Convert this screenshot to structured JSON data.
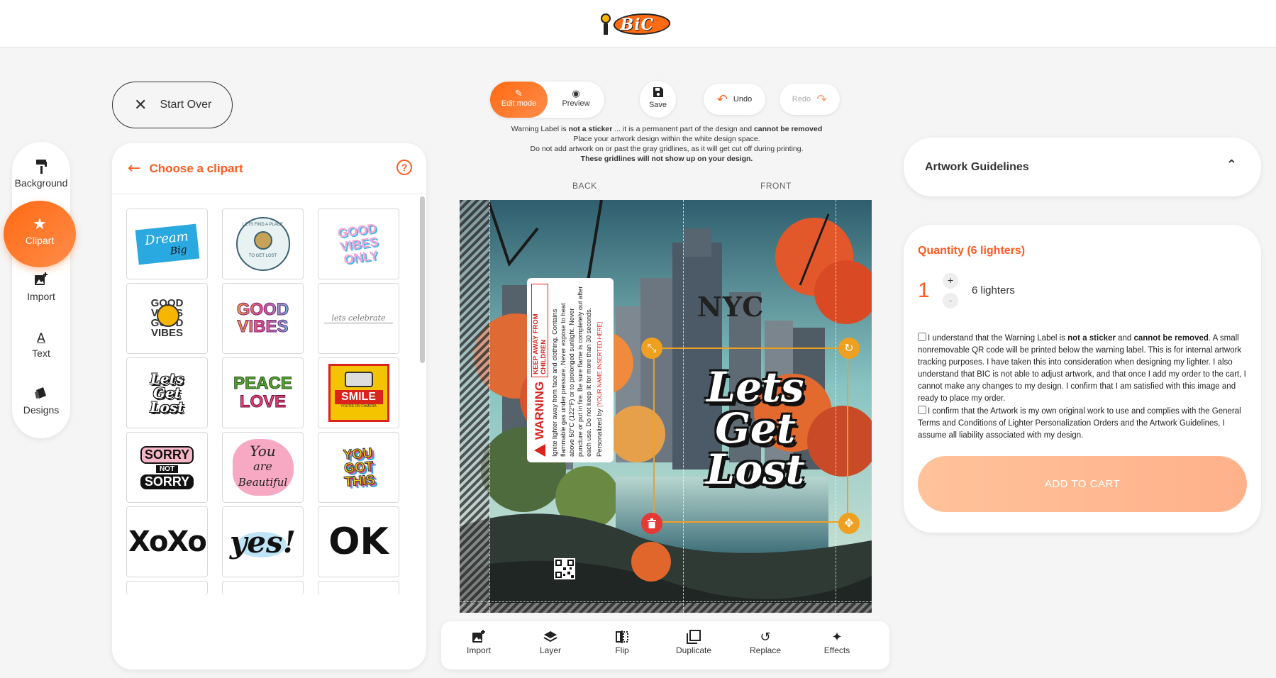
{
  "brand": {
    "logo_text": "BiC"
  },
  "start_over": {
    "label": "Start Over"
  },
  "rail": {
    "items": [
      {
        "label": "Background",
        "icon": "paint-roller-icon"
      },
      {
        "label": "Clipart",
        "icon": "star-icon",
        "active": true
      },
      {
        "label": "Import",
        "icon": "image-add-icon"
      },
      {
        "label": "Text",
        "icon": "text-icon"
      },
      {
        "label": "Designs",
        "icon": "designs-icon"
      }
    ]
  },
  "clipart": {
    "title": "Choose a clipart",
    "help": "?",
    "tiles": [
      {
        "label": "Dream Big"
      },
      {
        "label": "Lets find a place to get lost"
      },
      {
        "label": "Good Vibes Only"
      },
      {
        "label": "Good Vibes smiley"
      },
      {
        "label": "Good Vibes"
      },
      {
        "label": "Lets celebrate"
      },
      {
        "label": "Lets Get Lost"
      },
      {
        "label": "Peace Love"
      },
      {
        "label": "Smile You're on camera"
      },
      {
        "label": "Sorry Not Sorry"
      },
      {
        "label": "You are Beautiful"
      },
      {
        "label": "You Got This"
      },
      {
        "label": "XoXo"
      },
      {
        "label": "yes!"
      },
      {
        "label": "OK"
      }
    ],
    "tile_text": {
      "t0a": "Dream",
      "t0b": "Big",
      "t1": "LETS FIND A PLACE",
      "t1b": "TO GET LOST",
      "t2": "GOOD VIBES ONLY",
      "t3": "GOOD VIBES",
      "t4a": "GOOD",
      "t4b": "VIBES",
      "t5": "lets celebrate",
      "t6a": "Lets",
      "t6b": "Get",
      "t6c": "Lost",
      "t7a": "PEACE",
      "t7b": "LOVE",
      "t8": "SMILE",
      "t8b": "YOU'RE ON CAMERA",
      "t9a": "SORRY",
      "t9b": "NOT",
      "t9c": "SORRY",
      "t10a": "You",
      "t10b": "are",
      "t10c": "Beautiful",
      "t11a": "YOU",
      "t11b": "GOT",
      "t11c": "THIS",
      "t12": "XoXo",
      "t13": "yes!",
      "t14": "OK"
    }
  },
  "mode": {
    "edit_label": "Edit mode",
    "preview_label": "Preview"
  },
  "toolbar_top": {
    "save_label": "Save",
    "undo_label": "Undo",
    "redo_label": "Redo"
  },
  "notice": {
    "line1_a": "Warning Label is ",
    "line1_b": "not a sticker",
    "line1_c": " ... it is a permanent part of the design and ",
    "line1_d": "cannot be removed",
    "line2": "Place your artwork design within the white design space.",
    "line3": "Do not add artwork on or past the gray gridlines, as it will get cut off during printing.",
    "line4": "These gridlines will not show up on your design."
  },
  "canvas": {
    "back_label": "BACK",
    "front_label": "FRONT",
    "nyc_text": "NYC",
    "art_line1": "Lets",
    "art_line2": "Get",
    "art_line3": "Lost",
    "warning": {
      "title": "WARNING",
      "subtitle": "KEEP AWAY FROM CHILDREN",
      "body": "Ignite lighter away from face and clothing. Contains flammable gas under pressure. Never expose to heat above 50°C (122°F) or to prolonged sunlight. Never puncture or put in fire. Be sure flame is completely out after each use. Do not keep lit for more than 30 seconds.",
      "personalized": "Personalized by ",
      "name_placeholder": "[YOUR NAME INSERTED HERE]"
    }
  },
  "tools": [
    {
      "label": "Import",
      "icon": "image-add-icon"
    },
    {
      "label": "Layer",
      "icon": "layers-icon"
    },
    {
      "label": "Flip",
      "icon": "flip-icon"
    },
    {
      "label": "Duplicate",
      "icon": "duplicate-icon"
    },
    {
      "label": "Replace",
      "icon": "replace-icon"
    },
    {
      "label": "Effects",
      "icon": "sparkle-icon"
    }
  ],
  "guidelines": {
    "title": "Artwork Guidelines"
  },
  "order": {
    "qty_title": "Quantity (6 lighters)",
    "qty_value": "1",
    "qty_plus": "+",
    "qty_minus": "-",
    "qty_label": "6 lighters",
    "consent1_a": "I understand that the Warning Label is ",
    "consent1_b": "not a sticker",
    "consent1_c": " and ",
    "consent1_d": "cannot be removed",
    "consent1_e": ". A small nonremovable QR code will be printed below the warning label. This is for internal artwork tracking purposes. I have taken this into consideration when designing my lighter. I also understand that BIC is not able to adjust artwork, and that once I add my order to the cart, I cannot make any changes to my design. I confirm that I am satisfied with this image and ready to place my order.",
    "consent2": "I confirm that the Artwork is my own original work to use and complies with the General Terms and Conditions of Lighter Personalization Orders and the Artwork Guidelines, I assume all liability associated with my design.",
    "add_to_cart": "ADD TO CART"
  },
  "colors": {
    "accent": "#ff6a13",
    "accent_text": "#ff5a1f",
    "warning_red": "#d9231c",
    "selection": "#f0a020"
  }
}
